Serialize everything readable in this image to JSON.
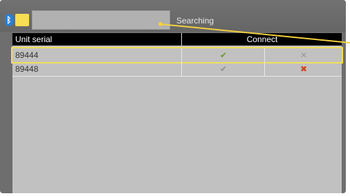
{
  "status_text": "Searching",
  "table": {
    "headers": {
      "serial": "Unit serial",
      "connect": "Connect"
    },
    "rows": [
      {
        "serial": "89444",
        "connect_check": "✔",
        "connect_x": "✕",
        "selected": true
      },
      {
        "serial": "89448",
        "connect_check": "✔",
        "connect_x": "✖",
        "selected": false
      }
    ]
  },
  "icons": {
    "bluetooth": "bluetooth-icon",
    "folder": "folder-icon",
    "check": "check-icon",
    "cross": "x-icon"
  },
  "colors": {
    "selection": "#f1df5a",
    "bluetooth_blue": "#2d7fd0",
    "folder_yellow": "#f6dd53",
    "check_active": "#6a9a28",
    "x_active": "#c94a1f"
  }
}
